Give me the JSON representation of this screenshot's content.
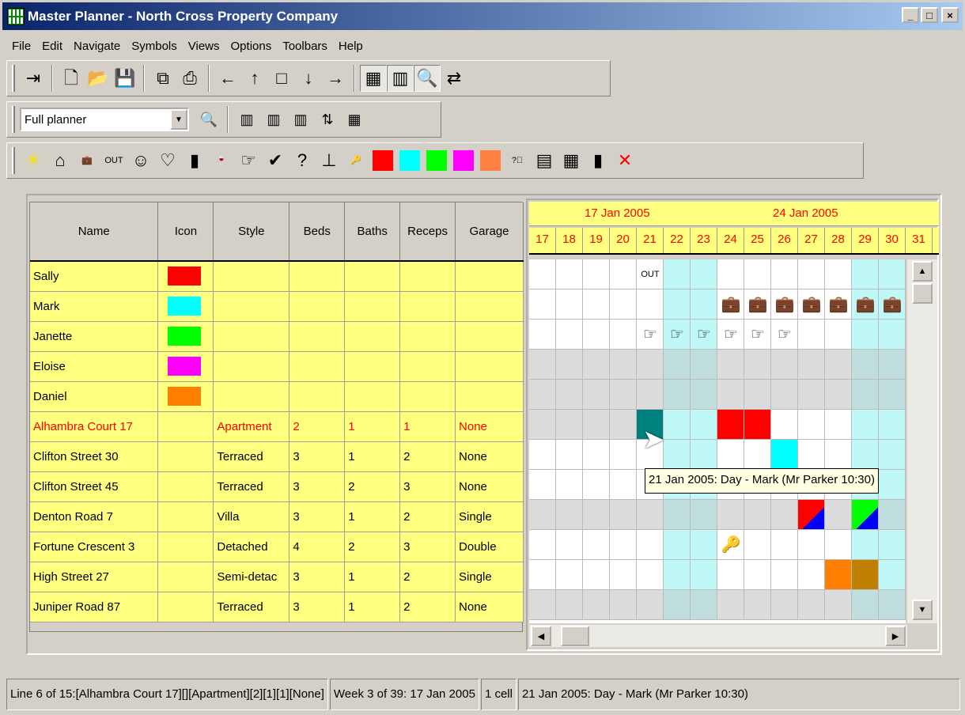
{
  "window": {
    "title": "Master Planner - North Cross Property Company",
    "minimize": "_",
    "maximize": "□",
    "close": "×"
  },
  "menu": [
    "File",
    "Edit",
    "Navigate",
    "Symbols",
    "Views",
    "Options",
    "Toolbars",
    "Help"
  ],
  "toolbar1": [
    {
      "icon": "exit-icon",
      "glyph": "⇥"
    },
    {
      "icon": "new-document-icon",
      "glyph": "🗋"
    },
    {
      "icon": "open-folder-icon",
      "glyph": "📂"
    },
    {
      "icon": "save-icon",
      "glyph": "💾"
    },
    {
      "icon": "copy-icon",
      "glyph": "⧉"
    },
    {
      "icon": "print-icon",
      "glyph": "⎙"
    },
    {
      "icon": "arrow-left-icon",
      "glyph": "←"
    },
    {
      "icon": "arrow-up-icon",
      "glyph": "↑"
    },
    {
      "icon": "square-icon",
      "glyph": "□"
    },
    {
      "icon": "arrow-down-icon",
      "glyph": "↓"
    },
    {
      "icon": "arrow-right-icon",
      "glyph": "→"
    },
    {
      "icon": "grid-view-icon",
      "glyph": "▦"
    },
    {
      "icon": "column-view-icon",
      "glyph": "▥"
    },
    {
      "icon": "zoom-search-icon",
      "glyph": "🔍"
    },
    {
      "icon": "swap-icon",
      "glyph": "⇄"
    }
  ],
  "toolbar2": {
    "view_select": "Full planner",
    "dropdown_arrow": "▼",
    "icons": [
      {
        "icon": "search-icon",
        "glyph": "🔍"
      },
      {
        "icon": "insert-column-icon",
        "glyph": "▥"
      },
      {
        "icon": "delete-column-icon",
        "glyph": "▥"
      },
      {
        "icon": "mark-column-icon",
        "glyph": "▥"
      },
      {
        "icon": "sort-column-icon",
        "glyph": "⇅"
      },
      {
        "icon": "calendar-icon",
        "glyph": "▦"
      }
    ]
  },
  "toolbar3": [
    {
      "icon": "sun-icon",
      "glyph": "☀"
    },
    {
      "icon": "question-house-icon",
      "glyph": "⌂"
    },
    {
      "icon": "briefcase-icon",
      "glyph": "💼"
    },
    {
      "icon": "out-sign-icon",
      "glyph": "OUT"
    },
    {
      "icon": "smiley-icon",
      "glyph": "☺"
    },
    {
      "icon": "balloons-icon",
      "glyph": "♡"
    },
    {
      "icon": "door-icon",
      "glyph": "▮"
    },
    {
      "icon": "wine-glass-icon",
      "glyph": "🍷"
    },
    {
      "icon": "hand-key-icon",
      "glyph": "☞"
    },
    {
      "icon": "checkmark-icon",
      "glyph": "✔"
    },
    {
      "icon": "question-mark-icon",
      "glyph": "?"
    },
    {
      "icon": "table-icon",
      "glyph": "⊥"
    },
    {
      "icon": "key-icon",
      "glyph": "🔑"
    },
    {
      "icon": "red-swatch-icon",
      "color": "#ff0000"
    },
    {
      "icon": "cyan-swatch-icon",
      "color": "#00ffff"
    },
    {
      "icon": "green-swatch-icon",
      "color": "#00ff00"
    },
    {
      "icon": "magenta-swatch-icon",
      "color": "#ff00ff"
    },
    {
      "icon": "orange-swatch-icon",
      "color": "#ff8040"
    },
    {
      "icon": "page-question-icon",
      "glyph": "?⃞"
    },
    {
      "icon": "page-single-icon",
      "glyph": "▤"
    },
    {
      "icon": "page-double-icon",
      "glyph": "▦"
    },
    {
      "icon": "flag-icon",
      "glyph": "▮"
    },
    {
      "icon": "delete-x-icon",
      "glyph": "✕"
    }
  ],
  "table": {
    "headers": [
      "Name",
      "Icon",
      "Style",
      "Beds",
      "Baths",
      "Receps",
      "Garage"
    ],
    "rows": [
      {
        "name": "Sally",
        "color": "#ff0000",
        "style": "",
        "beds": "",
        "baths": "",
        "receps": "",
        "garage": ""
      },
      {
        "name": "Mark",
        "color": "#00ffff",
        "style": "",
        "beds": "",
        "baths": "",
        "receps": "",
        "garage": ""
      },
      {
        "name": "Janette",
        "color": "#00ff00",
        "style": "",
        "beds": "",
        "baths": "",
        "receps": "",
        "garage": ""
      },
      {
        "name": "Eloise",
        "color": "#ff00ff",
        "style": "",
        "beds": "",
        "baths": "",
        "receps": "",
        "garage": ""
      },
      {
        "name": "Daniel",
        "color": "#ff8000",
        "style": "",
        "beds": "",
        "baths": "",
        "receps": "",
        "garage": ""
      },
      {
        "name": "Alhambra Court 17",
        "color": "",
        "style": "Apartment",
        "beds": "2",
        "baths": "1",
        "receps": "1",
        "garage": "None",
        "highlight": true
      },
      {
        "name": "Clifton Street 30",
        "color": "",
        "style": "Terraced",
        "beds": "3",
        "baths": "1",
        "receps": "2",
        "garage": "None"
      },
      {
        "name": "Clifton Street 45",
        "color": "",
        "style": "Terraced",
        "beds": "3",
        "baths": "2",
        "receps": "3",
        "garage": "None"
      },
      {
        "name": "Denton Road 7",
        "color": "",
        "style": "Villa",
        "beds": "3",
        "baths": "1",
        "receps": "2",
        "garage": "Single"
      },
      {
        "name": "Fortune Crescent 3",
        "color": "",
        "style": "Detached",
        "beds": "4",
        "baths": "2",
        "receps": "3",
        "garage": "Double"
      },
      {
        "name": "High Street 27",
        "color": "",
        "style": "Semi-detac",
        "beds": "3",
        "baths": "1",
        "receps": "2",
        "garage": "Single"
      },
      {
        "name": "Juniper Road 87",
        "color": "",
        "style": "Terraced",
        "beds": "3",
        "baths": "1",
        "receps": "2",
        "garage": "None"
      }
    ]
  },
  "calendar": {
    "weeks": [
      "17 Jan 2005",
      "24 Jan 2005"
    ],
    "days": [
      "17",
      "18",
      "19",
      "20",
      "21",
      "22",
      "23",
      "24",
      "25",
      "26",
      "27",
      "28",
      "29",
      "30",
      "31"
    ],
    "weekend_cols": [
      5,
      6,
      12,
      13
    ],
    "grey_rows": [
      3,
      4,
      8,
      11
    ],
    "symbols": [
      {
        "row": 0,
        "col": 4,
        "glyph": "OUT",
        "name": "out-sign-icon"
      },
      {
        "row": 1,
        "col": 7,
        "glyph": "💼",
        "name": "briefcase-icon"
      },
      {
        "row": 1,
        "col": 8,
        "glyph": "💼",
        "name": "briefcase-icon"
      },
      {
        "row": 1,
        "col": 9,
        "glyph": "💼",
        "name": "briefcase-icon"
      },
      {
        "row": 1,
        "col": 10,
        "glyph": "💼",
        "name": "briefcase-icon"
      },
      {
        "row": 1,
        "col": 11,
        "glyph": "💼",
        "name": "briefcase-icon"
      },
      {
        "row": 1,
        "col": 12,
        "glyph": "💼",
        "name": "briefcase-icon"
      },
      {
        "row": 1,
        "col": 13,
        "glyph": "💼",
        "name": "briefcase-icon"
      },
      {
        "row": 2,
        "col": 4,
        "glyph": "☞",
        "name": "hand-key-icon"
      },
      {
        "row": 2,
        "col": 5,
        "glyph": "☞",
        "name": "hand-key-icon"
      },
      {
        "row": 2,
        "col": 6,
        "glyph": "☞",
        "name": "hand-key-icon"
      },
      {
        "row": 2,
        "col": 7,
        "glyph": "☞",
        "name": "hand-key-icon"
      },
      {
        "row": 2,
        "col": 8,
        "glyph": "☞",
        "name": "hand-key-icon"
      },
      {
        "row": 2,
        "col": 9,
        "glyph": "☞",
        "name": "hand-key-icon"
      },
      {
        "row": 9,
        "col": 7,
        "glyph": "🔑",
        "name": "key-icon"
      }
    ],
    "fills": [
      {
        "row": 5,
        "col": 4,
        "color": "#007f7f"
      },
      {
        "row": 5,
        "col": 7,
        "color": "#ff0000"
      },
      {
        "row": 5,
        "col": 8,
        "color": "#ff0000"
      },
      {
        "row": 6,
        "col": 9,
        "color": "#00ffff"
      },
      {
        "row": 8,
        "col": 10,
        "color": "#ff0000",
        "split": "#0000ff"
      },
      {
        "row": 8,
        "col": 12,
        "color": "#00ff00",
        "split": "#0000ff"
      },
      {
        "row": 10,
        "col": 11,
        "color": "#ff8000"
      },
      {
        "row": 10,
        "col": 12,
        "color": "#c08000"
      }
    ],
    "tooltip": "21 Jan 2005: Day - Mark (Mr Parker 10:30)"
  },
  "status": {
    "line": "Line 6 of 15:[Alhambra Court 17][][Apartment][2][1][1][None]",
    "week": "Week 3 of 39: 17 Jan 2005",
    "cells": "1 cell",
    "detail": "21 Jan 2005: Day - Mark (Mr Parker 10:30)"
  }
}
